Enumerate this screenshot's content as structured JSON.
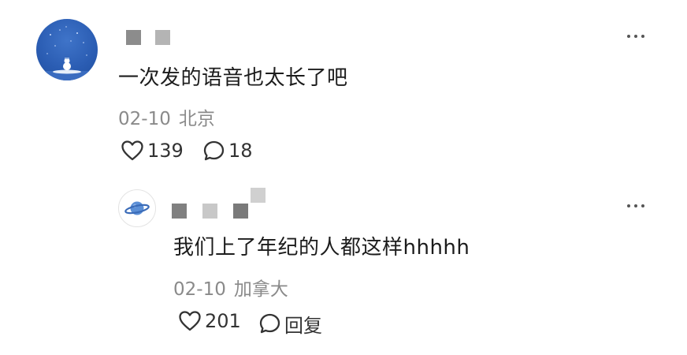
{
  "comment": {
    "avatar_icon": "night-sky-snowman-avatar",
    "username_pixel_colors": [
      "#8c8c8c",
      "#b4b4b4"
    ],
    "text": "一次发的语音也太长了吧",
    "date": "02-10",
    "location": "北京",
    "like_icon": "heart-outline-icon",
    "like_count": "139",
    "reply_icon": "speech-bubble-icon",
    "reply_count": "18",
    "more_icon": "more-dots-icon"
  },
  "reply": {
    "avatar_icon": "planet-avatar",
    "username_pixel_colors": [
      "#808080",
      "#c8c8c8",
      "#7a7a7a",
      "#d0d0d0"
    ],
    "text": "我们上了年纪的人都这样hhhhh",
    "date": "02-10",
    "location": "加拿大",
    "like_icon": "heart-outline-icon",
    "like_count": "201",
    "reply_icon": "speech-bubble-icon",
    "reply_label": "回复",
    "more_icon": "more-dots-icon"
  }
}
